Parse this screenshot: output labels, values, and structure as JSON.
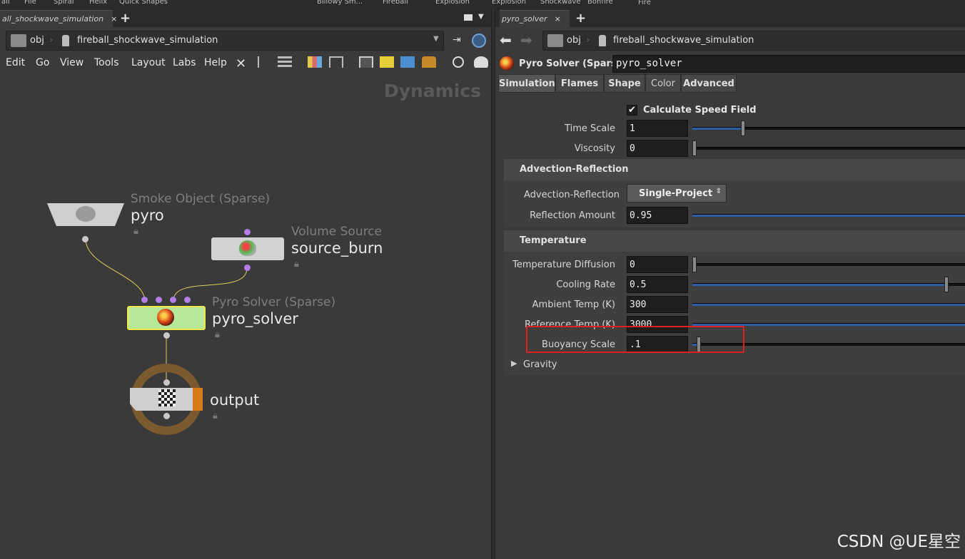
{
  "shelf": {
    "items": [
      "all",
      "File",
      "Spiral",
      "Helix",
      "Quick Shapes",
      "Billowy Sm...",
      "Fireball",
      "Explosion",
      "Explosion",
      "Shockwave",
      "Bonfire",
      "Fire"
    ]
  },
  "left": {
    "tab_label": "all_shockwave_simulation",
    "tab_close": "×",
    "tab_add": "+",
    "path": [
      "obj",
      "fireball_shockwave_simulation"
    ],
    "menu": [
      "Edit",
      "Go",
      "View",
      "Tools",
      "Layout",
      "Labs",
      "Help"
    ],
    "context_label": "Dynamics",
    "nodes": [
      {
        "type": "Smoke Object (Sparse)",
        "name": "pyro"
      },
      {
        "type": "Volume Source",
        "name": "source_burn"
      },
      {
        "type": "Pyro Solver (Sparse)",
        "name": "pyro_solver"
      },
      {
        "type": "",
        "name": "output"
      }
    ]
  },
  "right": {
    "tab_label": "pyro_solver",
    "tab_close": "×",
    "tab_add": "+",
    "path": [
      "obj",
      "fireball_shockwave_simulation"
    ],
    "node_type": "Pyro Solver (Sparse)",
    "node_name": "pyro_solver",
    "tabs": [
      "Simulation",
      "Flames",
      "Shape",
      "Color",
      "Advanced"
    ],
    "active_tab": "Simulation",
    "calc_speed_label": "Calculate Speed Field",
    "params_top": [
      {
        "label": "Time Scale",
        "value": "1",
        "fill": 0.18
      },
      {
        "label": "Viscosity",
        "value": "0",
        "fill": 0.0
      }
    ],
    "advection_section": "Advection-Reflection",
    "advection_label": "Advection-Reflection",
    "advection_value": "Single-Project",
    "reflection_label": "Reflection Amount",
    "reflection_value": "0.95",
    "temperature_section": "Temperature",
    "temp_params": [
      {
        "label": "Temperature Diffusion",
        "value": "0",
        "fill": 0.0
      },
      {
        "label": "Cooling Rate",
        "value": "0.5",
        "fill": 0.93
      },
      {
        "label": "Ambient Temp (K)",
        "value": "300",
        "fill": 1.0
      },
      {
        "label": "Reference Temp (K)",
        "value": "3000",
        "fill": 1.0
      },
      {
        "label": "Buoyancy Scale",
        "value": ".1",
        "fill": 0.02
      }
    ],
    "gravity_label": "Gravity"
  },
  "watermark": "CSDN @UE星空",
  "colors": {
    "accent_blue": "#2f5ea6",
    "highlight_red": "#e02020",
    "solver_green": "#b6e89a",
    "selected_yellow": "#f2e64a",
    "output_ring": "#7a5a2e"
  }
}
